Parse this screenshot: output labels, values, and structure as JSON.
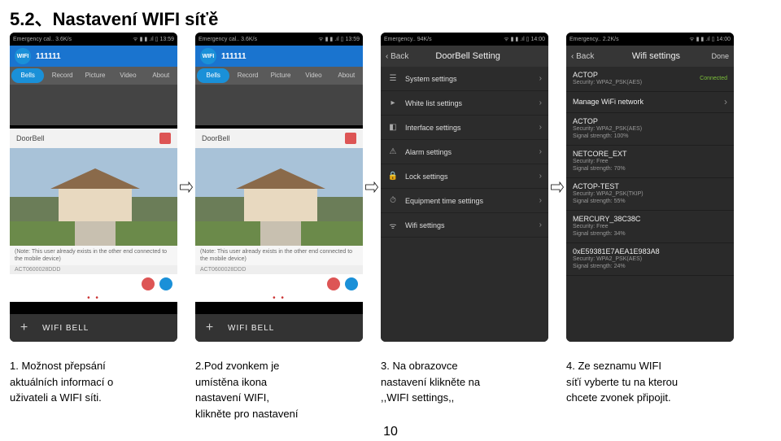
{
  "heading": "5.2、Nastavení WIFI síťě",
  "status": {
    "left12": "Emergency cal..   3.6K/s",
    "left3": "Emergency..   94K/s",
    "left4": "Emergency..   2.2K/s",
    "time12": "13:59",
    "time34": "14:00"
  },
  "phone12": {
    "title": "111111",
    "tabs": [
      "Bells",
      "Record",
      "Picture",
      "Video",
      "About"
    ],
    "device": "DoorBell",
    "info1": "(Note: This user already exists in the other end connected to the mobile device)",
    "info2": "ACT0600028DDD",
    "bottom": "WIFI BELL"
  },
  "phone3": {
    "back": "‹ Back",
    "title": "DoorBell Setting",
    "items": [
      {
        "icon": "☰",
        "label": "System settings"
      },
      {
        "icon": "▸",
        "label": "White list settings"
      },
      {
        "icon": "◧",
        "label": "Interface settings"
      },
      {
        "icon": "⚠",
        "label": "Alarm settings"
      },
      {
        "icon": "🔒",
        "label": "Lock settings"
      },
      {
        "icon": "⏱",
        "label": "Equipment time settings"
      },
      {
        "icon": "ᯤ",
        "label": "Wifi settings"
      }
    ]
  },
  "phone4": {
    "back": "‹ Back",
    "title": "Wifi settings",
    "done": "Done",
    "current": {
      "ssid": "ACTOP",
      "sec": "Security: WPA2_PSK(AES)",
      "conn": "Connected",
      "manage": "Manage WiFi network"
    },
    "networks": [
      {
        "ssid": "ACTOP",
        "l1": "Security: WPA2_PSK(AES)",
        "l2": "Signal strength: 100%"
      },
      {
        "ssid": "NETCORE_EXT",
        "l1": "Security: Free",
        "l2": "Signal strength: 70%"
      },
      {
        "ssid": "ACTOP-TEST",
        "l1": "Security: WPA2_PSK(TKIP)",
        "l2": "Signal strength: 55%"
      },
      {
        "ssid": "MERCURY_38C38C",
        "l1": "Security: Free",
        "l2": "Signal strength: 34%"
      },
      {
        "ssid": "0xE59381E7AEA1E983A8",
        "l1": "Security: WPA2_PSK(AES)",
        "l2": "Signal strength: 24%"
      }
    ]
  },
  "captions": {
    "c1a": "1. Možnost přepsání",
    "c1b": "aktuálních informací o",
    "c1c": "uživateli a WIFI síti.",
    "c2a": "2.Pod zvonkem je",
    "c2b": "umístěna ikona",
    "c2c": "nastavení WIFI,",
    "c2d": "klikněte pro nastavení",
    "c3a": "3. Na obrazovce",
    "c3b": "nastavení klikněte na",
    "c3c": ",,WIFI settings,,",
    "c4a": "4. Ze seznamu WIFI",
    "c4b": "síťí vyberte tu na kterou",
    "c4c": "chcete zvonek připojit."
  },
  "pagenum": "10"
}
